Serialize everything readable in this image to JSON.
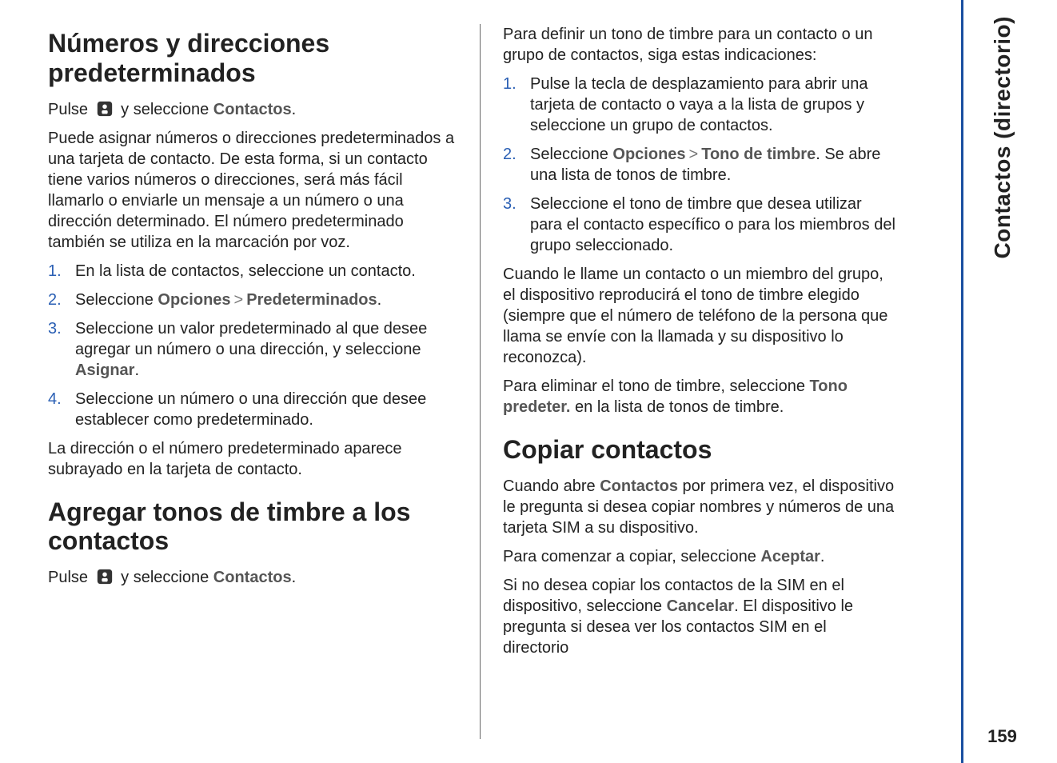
{
  "sidebar": {
    "title": "Contactos (directorio)",
    "page": "159"
  },
  "left": {
    "h1": "Números y direcciones predeterminados",
    "p1a": "Pulse ",
    "p1b": " y seleccione ",
    "p1c_bold": "Contactos",
    "p1d": ".",
    "p2": "Puede asignar números o direcciones predeterminados a una tarjeta de contacto. De esta forma, si un contacto tiene varios números o direcciones, será más fácil llamarlo o enviarle un mensaje a un número o una dirección determinado. El número predeterminado también se utiliza en la marcación por voz.",
    "list1": [
      {
        "n": "1.",
        "t": "En la lista de contactos, seleccione un contacto."
      },
      {
        "n": "2.",
        "t_pre": "Seleccione ",
        "b1": "Opciones",
        "sep": ">",
        "b2": "Predeterminados",
        "t_post": "."
      },
      {
        "n": "3.",
        "t_pre": "Seleccione un valor predeterminado al que desee agregar un número o una dirección, y seleccione ",
        "b1": "Asignar",
        "t_post": "."
      },
      {
        "n": "4.",
        "t": "Seleccione un número o una dirección que desee establecer como predeterminado."
      }
    ],
    "p3": "La dirección o el número predeterminado aparece subrayado en la tarjeta de contacto.",
    "h2": "Agregar tonos de timbre a los contactos",
    "p4a": "Pulse ",
    "p4b": " y seleccione ",
    "p4c_bold": "Contactos",
    "p4d": "."
  },
  "right": {
    "p1": "Para definir un tono de timbre para un contacto o un grupo de contactos, siga estas indicaciones:",
    "list1": [
      {
        "n": "1.",
        "t": "Pulse la tecla de desplazamiento para abrir una tarjeta de contacto o vaya a la lista de grupos y seleccione un grupo de contactos."
      },
      {
        "n": "2.",
        "t_pre": "Seleccione ",
        "b1": "Opciones",
        "sep": ">",
        "b2": "Tono de timbre",
        "t_post": ". Se abre una lista de tonos de timbre."
      },
      {
        "n": "3.",
        "t": "Seleccione el tono de timbre que desea utilizar para el contacto específico o para los miembros del grupo seleccionado."
      }
    ],
    "p2": "Cuando le llame un contacto o un miembro del grupo, el dispositivo reproducirá el tono de timbre elegido (siempre que el número de teléfono de la persona que llama se envíe con la llamada y su dispositivo lo reconozca).",
    "p3a": "Para eliminar el tono de timbre, seleccione ",
    "p3b_bold": "Tono predeter.",
    "p3c": " en la lista de tonos de timbre.",
    "h1": "Copiar contactos",
    "p4a": "Cuando abre ",
    "p4b_bold": "Contactos",
    "p4c": " por primera vez, el dispositivo le pregunta si desea copiar nombres y números de una tarjeta SIM a su dispositivo.",
    "p5a": "Para comenzar a copiar, seleccione ",
    "p5b_bold": "Aceptar",
    "p5c": ".",
    "p6a": "Si no desea copiar los contactos de la SIM en el dispositivo, seleccione ",
    "p6b_bold": "Cancelar",
    "p6c": ". El dispositivo le pregunta si desea ver los contactos SIM en el directorio"
  }
}
